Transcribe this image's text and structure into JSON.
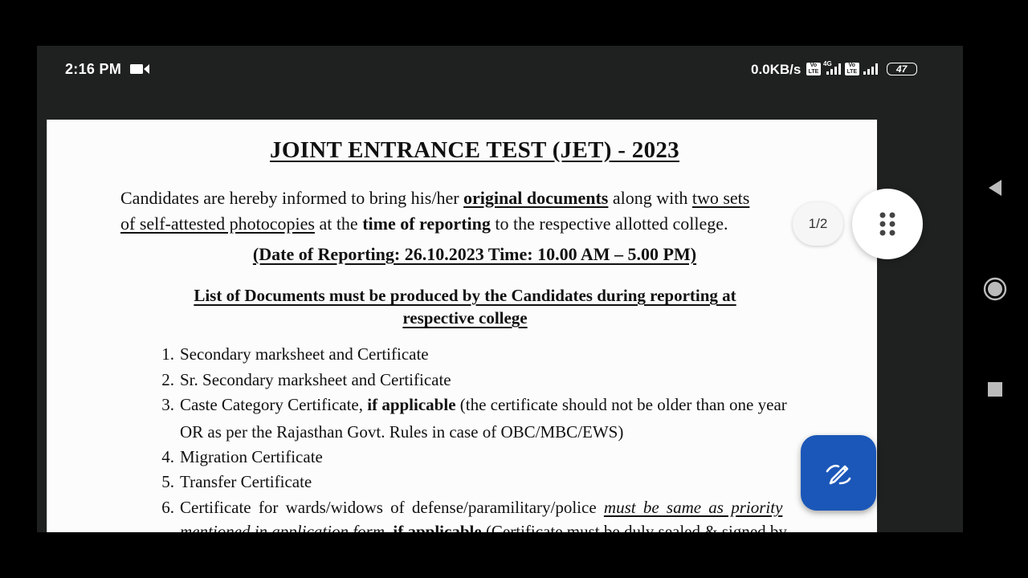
{
  "status_bar": {
    "time": "2:16 PM",
    "net_speed": "0.0KB/s",
    "volte": "Vo LTE",
    "net_type": "4G",
    "battery": "47"
  },
  "page_indicator": "1/2",
  "document": {
    "title": "JOINT ENTRANCE TEST (JET) - 2023",
    "intro": {
      "l1_a": "Candidates are hereby informed to bring his/her ",
      "l1_b": "original documents",
      "l1_c": " along with ",
      "l1_d": "two sets",
      "l2_a": "of self-attested photocopies",
      "l2_b": " at the ",
      "l2_c": "time of reporting",
      "l2_d": " to the respective allotted college."
    },
    "reporting_date": "(Date of Reporting: 26.10.2023 Time: 10.00 AM – 5.00 PM)",
    "list_heading_1": "List of Documents must be produced by the Candidates during reporting at",
    "list_heading_2": "respective college",
    "items": [
      {
        "num": "1.",
        "text": "Secondary marksheet and Certificate"
      },
      {
        "num": "2.",
        "text": "Sr. Secondary marksheet and Certificate"
      },
      {
        "num": "3.",
        "text_a": "Caste Category Certificate, ",
        "text_b": "if applicable",
        "text_c": " (the certificate should not be older than one year",
        "text_d": "OR as per the Rajasthan Govt. Rules in case of OBC/MBC/EWS)"
      },
      {
        "num": "4.",
        "text": "Migration Certificate"
      },
      {
        "num": "5.",
        "text": "Transfer Certificate"
      },
      {
        "num": "6.",
        "text_a": "Certificate for wards/widows of defense/paramilitary/police ",
        "text_b": "must be same as priority",
        "text_c": "mentioned in application form",
        "text_d": ", ",
        "text_e": "if applicable",
        "text_f": " (Certificate must be duly sealed & signed by"
      }
    ]
  },
  "colors": {
    "fab": "#1b57b8",
    "frame": "#1e2120",
    "page": "#fbfcfb"
  }
}
